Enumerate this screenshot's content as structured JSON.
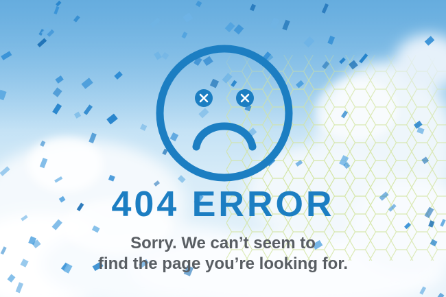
{
  "error_page": {
    "headline": "404 ERROR",
    "message_line1": "Sorry. We can’t seem to",
    "message_line2": "find the page you’re looking for.",
    "icon": "sad-face-icon",
    "eyes_icon": "x-mark-icon"
  },
  "colors": {
    "brand_blue": "#1c7ec2",
    "message_gray": "#595e63",
    "sky_top": "#8cc6ec",
    "sky_bottom": "#eaf4fb",
    "hex_outline": "#d6e6a2"
  }
}
